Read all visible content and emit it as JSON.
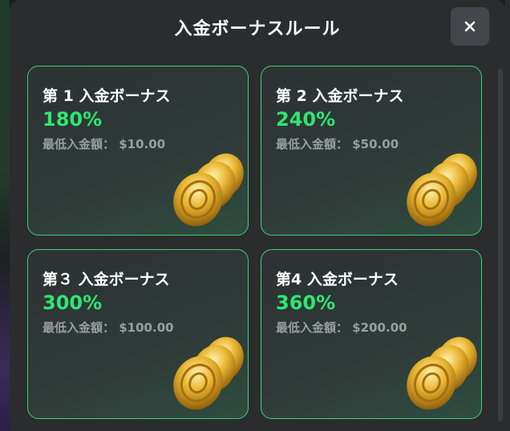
{
  "modal": {
    "title": "入金ボーナスルール",
    "close_icon": "close-icon"
  },
  "cards": [
    {
      "title": "第 1 入金ボーナス",
      "percent": "180%",
      "min_label": "最低入金額：",
      "min_value": "$10.00"
    },
    {
      "title": "第 2 入金ボーナス",
      "percent": "240%",
      "min_label": "最低入金額：",
      "min_value": "$50.00"
    },
    {
      "title": "第３ 入金ボーナス",
      "percent": "300%",
      "min_label": "最低入金額：",
      "min_value": "$100.00"
    },
    {
      "title": "第4 入金ボーナス",
      "percent": "360%",
      "min_label": "最低入金額：",
      "min_value": "$200.00"
    }
  ],
  "colors": {
    "accent": "#2ee673",
    "card_border": "#3fd07a",
    "modal_bg": "#2a2c2e"
  }
}
